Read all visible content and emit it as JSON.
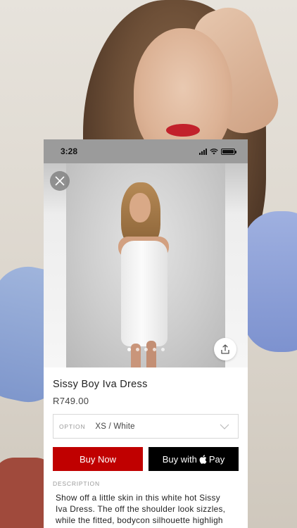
{
  "status_bar": {
    "time": "3:28"
  },
  "product": {
    "name": "Sissy Boy Iva Dress",
    "price": "R749.00",
    "option_label": "OPTION",
    "option_value": "XS / White",
    "gallery_page_count": 5,
    "gallery_active_page": 1
  },
  "buttons": {
    "buy_now": "Buy Now",
    "buy_with": "Buy with",
    "pay": "Pay"
  },
  "description": {
    "heading": "DESCRIPTION",
    "text": "Show off a little skin in this white hot Sissy\nIva Dress. The off the shoulder look sizzles,\nwhile the fitted, bodycon silhouette highligh\nyour best curves. Pure"
  },
  "colors": {
    "buy_now_bg": "#c00000",
    "apple_pay_bg": "#000000",
    "status_bar_bg": "#9b9b9b"
  },
  "icons": {
    "close": "close-icon",
    "share": "share-icon",
    "chevron": "chevron-down-icon",
    "apple": "apple-logo-icon"
  }
}
